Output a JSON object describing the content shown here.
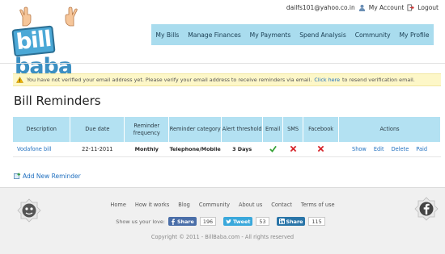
{
  "header": {
    "email": "dailfs101@yahoo.co.in",
    "my_account": "My Account",
    "logout": "Logout"
  },
  "logo": {
    "part1": "bill",
    "part2": "baba"
  },
  "nav": {
    "items": [
      "My Bills",
      "Manage Finances",
      "My Payments",
      "Spend Analysis",
      "Community",
      "My Profile"
    ]
  },
  "notice": {
    "text": "You have not verified your email address yet. Please verify your email address to receive reminders via email.",
    "link": "Click here",
    "suffix": "to resend verification email."
  },
  "page_title": "Bill Reminders",
  "table": {
    "headers": [
      "Description",
      "Due date",
      "Reminder frequency",
      "Reminder category",
      "Alert threshold",
      "Email",
      "SMS",
      "Facebook",
      "Actions"
    ],
    "rows": [
      {
        "description": "Vodafone bill",
        "due_date": "22-11-2011",
        "frequency": "Monthly",
        "category": "Telephone/Mobile",
        "threshold": "3 Days",
        "email": "check",
        "sms": "cross",
        "facebook": "cross",
        "actions": [
          "Show",
          "Edit",
          "Delete",
          "Paid"
        ]
      }
    ]
  },
  "add_new": "Add New Reminder",
  "footer": {
    "links": [
      "Home",
      "How it works",
      "Blog",
      "Community",
      "About us",
      "Contact",
      "Terms of use"
    ],
    "share_label": "Show us your love:",
    "share": {
      "facebook_label": "Share",
      "facebook_count": "196",
      "twitter_label": "Tweet",
      "twitter_count": "53",
      "linkedin_label": "Share",
      "linkedin_count": "115"
    },
    "copyright": "Copyright © 2011 - BillBaba.com - All rights reserved"
  },
  "colors": {
    "nav_bg": "#a9dcee",
    "table_header_bg": "#b3e1f2",
    "notice_bg": "#fdf7c8",
    "link": "#1f6fbf",
    "check": "#3aa33a",
    "cross": "#d6262c"
  }
}
